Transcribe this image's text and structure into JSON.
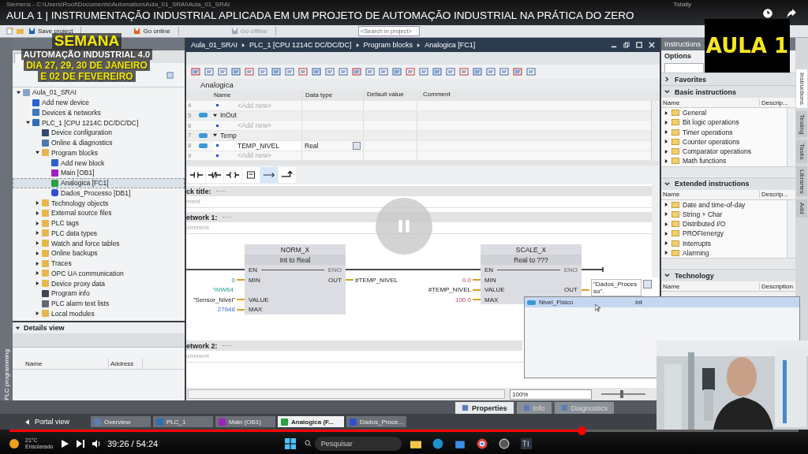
{
  "app": {
    "title": "Siemens - C:\\Users\\Root\\Documents\\Automation\\Aula_01_SRAI\\Aula_01_SRAI",
    "brand": "Totally"
  },
  "video": {
    "title": "AULA 1 | INSTRUMENTAÇÃO INDUSTRIAL APLICADA EM UM PROJETO DE AUTOMAÇÃO INDUSTRIAL NA PRÁTICA DO ZERO",
    "badge": "AULA 1",
    "promo": [
      "SEMANA",
      "AUTOMAÇÃO INDUSTRIAL 4.0",
      "DIA 27, 29, 30 DE JANEIRO",
      "E 02 DE FEVEREIRO"
    ],
    "progress": {
      "level": 0.725
    },
    "time": "39:26 / 54:24"
  },
  "toolbar": {
    "buttons": [
      {
        "label": "Save project",
        "disabled": false
      },
      {
        "label": "Go online",
        "disabled": false
      },
      {
        "label": "Go offline",
        "disabled": true
      }
    ],
    "search": {
      "placeholder": "<Search in project>"
    }
  },
  "side_strip": "PLC programming",
  "tree": {
    "items": [
      {
        "label": "Aula_01_SRAI",
        "kind": "project",
        "expanded": true,
        "selected": false,
        "children": [
          {
            "label": "Add new device",
            "kind": "add",
            "selected": false
          },
          {
            "label": "Devices & networks",
            "kind": "network",
            "selected": false
          },
          {
            "label": "PLC_1 [CPU 1214C DC/DC/DC]",
            "kind": "plc",
            "expanded": true,
            "selected": false,
            "children": [
              {
                "label": "Device configuration",
                "kind": "config",
                "selected": false
              },
              {
                "label": "Online & diagnostics",
                "kind": "diag",
                "selected": false
              },
              {
                "label": "Program blocks",
                "kind": "folder",
                "expanded": true,
                "selected": false,
                "children": [
                  {
                    "label": "Add new block",
                    "kind": "add",
                    "selected": false
                  },
                  {
                    "label": "Main [OB1]",
                    "kind": "ob",
                    "selected": false
                  },
                  {
                    "label": "Analogica [FC1]",
                    "kind": "fc",
                    "selected": true
                  },
                  {
                    "label": "Dados_Processo [DB1]",
                    "kind": "db",
                    "selected": false
                  }
                ]
              },
              {
                "label": "Technology objects",
                "kind": "folder",
                "expanded": false,
                "selected": false
              },
              {
                "label": "External source files",
                "kind": "folder",
                "expanded": false,
                "selected": false
              },
              {
                "label": "PLC tags",
                "kind": "folder",
                "expanded": false,
                "selected": false
              },
              {
                "label": "PLC data types",
                "kind": "folder",
                "expanded": false,
                "selected": false
              },
              {
                "label": "Watch and force tables",
                "kind": "folder",
                "expanded": false,
                "selected": false
              },
              {
                "label": "Online backups",
                "kind": "folder",
                "expanded": false,
                "selected": false
              },
              {
                "label": "Traces",
                "kind": "folder",
                "expanded": false,
                "selected": false
              },
              {
                "label": "OPC UA communication",
                "kind": "folder",
                "expanded": false,
                "selected": false
              },
              {
                "label": "Device proxy data",
                "kind": "folder",
                "expanded": false,
                "selected": false
              },
              {
                "label": "Program info",
                "kind": "info",
                "selected": false
              },
              {
                "label": "PLC alarm text lists",
                "kind": "list",
                "selected": false
              },
              {
                "label": "Local modules",
                "kind": "folder",
                "expanded": false,
                "selected": false
              }
            ]
          }
        ]
      }
    ]
  },
  "details": {
    "title": "Details view",
    "columns": [
      "Name",
      "Address"
    ]
  },
  "editor": {
    "breadcrumb": [
      "Aula_01_SRAI",
      "PLC_1 [CPU 1214C DC/DC/DC]",
      "Program blocks",
      "Analogica [FC1]"
    ],
    "block": "Analogica",
    "interface": {
      "columns": [
        "Name",
        "Data type",
        "Default value",
        "Comment"
      ],
      "rows": [
        {
          "num": "4",
          "kind": "add",
          "name": "<Add new>"
        },
        {
          "num": "5",
          "kind": "section",
          "name": "InOut",
          "expanded": true
        },
        {
          "num": "6",
          "kind": "add",
          "name": "<Add new>"
        },
        {
          "num": "7",
          "kind": "section",
          "name": "Temp",
          "expanded": true
        },
        {
          "num": "8",
          "kind": "var",
          "name": "TEMP_NIVEL",
          "type": "Real"
        },
        {
          "num": "9",
          "kind": "add",
          "name": "<Add new>"
        }
      ]
    },
    "block_title": "ck title:",
    "block_comment": "ment",
    "networks": [
      {
        "title": "etwork 1:",
        "comment": "omment"
      },
      {
        "title": "etwork 2:",
        "comment": "omment"
      }
    ],
    "blocks": [
      {
        "name": "NORM_X",
        "subtitle": "Int to Real",
        "inputs": [
          {
            "pin": "EN"
          },
          {
            "pin": "MIN",
            "arg": "0",
            "kind": "int"
          },
          {
            "pin": "VALUE",
            "address": "%IW64",
            "arg": "\"Sensor_Nivel\"",
            "kind": "tag"
          },
          {
            "pin": "MAX",
            "arg": "27648",
            "kind": "int"
          }
        ],
        "outputs": [
          {
            "pin": "ENO",
            "active": false
          },
          {
            "pin": "OUT",
            "active": true,
            "arg": "#TEMP_NIVEL",
            "kind": "local"
          }
        ]
      },
      {
        "name": "SCALE_X",
        "subtitle": "Real to ???",
        "inputs": [
          {
            "pin": "EN"
          },
          {
            "pin": "MIN",
            "arg": "0.0",
            "kind": "real"
          },
          {
            "pin": "VALUE",
            "arg": "#TEMP_NIVEL",
            "kind": "local"
          },
          {
            "pin": "MAX",
            "arg": "100.0",
            "kind": "real"
          }
        ],
        "outputs": [
          {
            "pin": "ENO",
            "active": false
          },
          {
            "pin": "OUT",
            "active": true,
            "arg": "\"Dados_Processo\".",
            "kind": "editing"
          }
        ]
      }
    ],
    "zoom": "100%",
    "zoom_slider": {
      "level": 0.47
    }
  },
  "autocomplete": [
    {
      "name": "Nivel_Fisico",
      "type": "Int",
      "selected": true
    }
  ],
  "instructions": {
    "title": "Instructions",
    "options": "Options",
    "sections": [
      {
        "title": "Favorites",
        "expanded": false
      },
      {
        "title": "Basic instructions",
        "expanded": true,
        "columns": [
          "Name",
          "Descrip..."
        ],
        "items": [
          {
            "label": "General",
            "expanded": false
          },
          {
            "label": "Bit logic operations",
            "expanded": false
          },
          {
            "label": "Timer operations",
            "expanded": false
          },
          {
            "label": "Counter operations",
            "expanded": false
          },
          {
            "label": "Comparator operations",
            "expanded": false
          },
          {
            "label": "Math functions",
            "expanded": false
          }
        ]
      },
      {
        "title": "Extended instructions",
        "expanded": true,
        "columns": [
          "Name",
          "Descrip..."
        ],
        "items": [
          {
            "label": "Date and time-of-day",
            "expanded": false
          },
          {
            "label": "String + Char",
            "expanded": false
          },
          {
            "label": "Distributed I/O",
            "expanded": false
          },
          {
            "label": "PROFIenergy",
            "expanded": false
          },
          {
            "label": "Interrupts",
            "expanded": false
          },
          {
            "label": "Alarming",
            "expanded": false
          }
        ]
      },
      {
        "title": "Technology",
        "expanded": true,
        "columns": [
          "Name",
          "Description"
        ]
      }
    ]
  },
  "side_tabs": [
    {
      "label": "Instructions",
      "selected": true
    },
    {
      "label": "Testing",
      "selected": false
    },
    {
      "label": "Tasks",
      "selected": false
    },
    {
      "label": "Libraries",
      "selected": false
    },
    {
      "label": "Add",
      "selected": false
    }
  ],
  "bottom_tabs": [
    {
      "label": "Properties",
      "selected": true
    },
    {
      "label": "Info",
      "selected": false
    },
    {
      "label": "Diagnostics",
      "selected": false
    }
  ],
  "editor_tabs": {
    "portal": "Portal view",
    "tabs": [
      {
        "label": "Overview",
        "kind": "overview",
        "selected": false
      },
      {
        "label": "PLC_1",
        "kind": "plc",
        "selected": false
      },
      {
        "label": "Main (OB1)",
        "kind": "ob",
        "selected": false
      },
      {
        "label": "Analogica (F...",
        "kind": "fc",
        "selected": true
      },
      {
        "label": "Dados_Proce...",
        "kind": "db",
        "selected": false
      }
    ]
  },
  "windows": {
    "temperature": "21°C",
    "weather": "Ensolarado",
    "search": {
      "placeholder": "Pesquisar"
    }
  }
}
